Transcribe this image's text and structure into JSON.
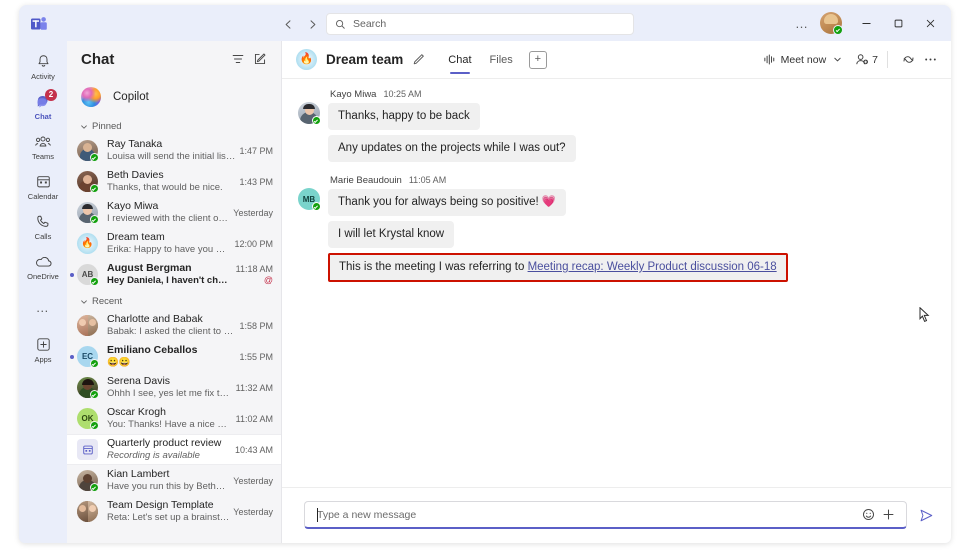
{
  "titlebar": {
    "app_logo": "teams-logo",
    "back_label": "Back",
    "forward_label": "Forward",
    "search_placeholder": "Search",
    "more_label": "…",
    "minimize_label": "Minimize",
    "maximize_label": "Maximize",
    "close_label": "Close"
  },
  "rail": {
    "items": [
      {
        "label": "Activity",
        "icon": "bell-icon",
        "badge": ""
      },
      {
        "label": "Chat",
        "icon": "chat-icon",
        "badge": "2"
      },
      {
        "label": "Teams",
        "icon": "teams-icon",
        "badge": ""
      },
      {
        "label": "Calendar",
        "icon": "calendar-icon",
        "badge": ""
      },
      {
        "label": "Calls",
        "icon": "phone-icon",
        "badge": ""
      },
      {
        "label": "OneDrive",
        "icon": "cloud-icon",
        "badge": ""
      }
    ],
    "more_label": "…",
    "apps_label": "Apps"
  },
  "chat_panel": {
    "title": "Chat",
    "filter_icon": "filter-icon",
    "compose_icon": "new-chat-icon",
    "copilot": {
      "label": "Copilot"
    },
    "groups": [
      {
        "label": "Pinned"
      },
      {
        "label": "Recent"
      }
    ],
    "pinned": [
      {
        "name": "Ray Tanaka",
        "preview": "Louisa will send the initial list of…",
        "time": "1:47 PM",
        "avatar_type": "photo",
        "avatar_color": "#8a7466",
        "initials": "RT",
        "unread": false,
        "bold": false,
        "mention": false
      },
      {
        "name": "Beth Davies",
        "preview": "Thanks, that would be nice.",
        "time": "1:43 PM",
        "avatar_type": "photo",
        "avatar_color": "#6b4a39",
        "initials": "BD",
        "unread": false,
        "bold": false,
        "mention": false
      },
      {
        "name": "Kayo Miwa",
        "preview": "I reviewed with the client on Th…",
        "time": "Yesterday",
        "avatar_type": "photo",
        "avatar_color": "#9fa8b8",
        "initials": "KM",
        "unread": false,
        "bold": false,
        "mention": false
      },
      {
        "name": "Dream team",
        "preview": "Erika: Happy to have you back…",
        "time": "12:00 PM",
        "avatar_type": "team",
        "avatar_color": "#a9dcef",
        "initials": "",
        "unread": false,
        "bold": false,
        "mention": false
      },
      {
        "name": "August Bergman",
        "preview": "Hey Daniela, I haven't checked…",
        "time": "11:18 AM",
        "avatar_type": "initials",
        "avatar_color": "#d6d6d6",
        "initials": "AB",
        "unread": true,
        "bold": true,
        "mention": true,
        "mention_glyph": "@"
      }
    ],
    "recent": [
      {
        "name": "Charlotte and Babak",
        "preview": "Babak: I asked the client to send…",
        "time": "1:58 PM",
        "avatar_type": "photo-duo",
        "avatar_color": "#a97f68",
        "initials": "CB",
        "unread": false,
        "bold": false,
        "mention": false
      },
      {
        "name": "Emiliano Ceballos",
        "preview": "😀😀",
        "time": "1:55 PM",
        "avatar_type": "initials",
        "avatar_color": "#9fd4ef",
        "initials": "EC",
        "unread": true,
        "bold": true,
        "mention": false
      },
      {
        "name": "Serena Davis",
        "preview": "Ohhh I see, yes let me fix that!",
        "time": "11:32 AM",
        "avatar_type": "photo",
        "avatar_color": "#4d3a2e",
        "initials": "SD",
        "unread": false,
        "bold": false,
        "mention": false
      },
      {
        "name": "Oscar Krogh",
        "preview": "You: Thanks! Have a nice day, I…",
        "time": "11:02 AM",
        "avatar_type": "initials",
        "avatar_color": "#a8d86a",
        "initials": "OK",
        "unread": false,
        "bold": false,
        "mention": false
      },
      {
        "name": "Quarterly product review",
        "preview": "Recording is available",
        "time": "10:43 AM",
        "avatar_type": "meeting",
        "avatar_color": "#e8e8f5",
        "initials": "",
        "unread": false,
        "bold": false,
        "italic": true,
        "selected": true,
        "mention": false
      },
      {
        "name": "Kian Lambert",
        "preview": "Have you run this by Beth? Mak…",
        "time": "Yesterday",
        "avatar_type": "photo",
        "avatar_color": "#8b6f5c",
        "initials": "KL",
        "unread": false,
        "bold": false,
        "mention": false
      },
      {
        "name": "Team Design Template",
        "preview": "Reta: Let's set up a brainstormi…",
        "time": "Yesterday",
        "avatar_type": "photo-duo",
        "avatar_color": "#7d6a59",
        "initials": "TD",
        "unread": false,
        "bold": false,
        "mention": false
      }
    ]
  },
  "main_header": {
    "team_name": "Dream team",
    "team_icon": "flame-icon",
    "edit_icon": "pencil-icon",
    "tabs": [
      {
        "label": "Chat",
        "active": true
      },
      {
        "label": "Files",
        "active": false
      }
    ],
    "add_tab_label": "+",
    "meet_now_label": "Meet now",
    "meet_now_icon": "meet-now-icon",
    "caret_icon": "chevron-down-icon",
    "people_count": "7",
    "people_icon": "people-icon",
    "copilot_icon": "copilot-icon",
    "more_icon": "more-options-icon"
  },
  "conversation": {
    "groups": [
      {
        "author": "Kayo Miwa",
        "time": "10:25 AM",
        "avatar_type": "photo",
        "avatar_color": "#9fa8b8",
        "initials": "KM",
        "messages": [
          {
            "text": "Thanks, happy to be back",
            "highlighted": false
          },
          {
            "text": "Any updates on the projects while I was out?",
            "highlighted": false
          }
        ]
      },
      {
        "author": "Marie Beaudouin",
        "time": "11:05 AM",
        "avatar_type": "initials",
        "avatar_color": "#6fd0c9",
        "initials": "MB",
        "messages": [
          {
            "text": "Thank you for always being so positive! ",
            "emoji": "💗",
            "highlighted": false
          },
          {
            "text": "I will let Krystal know",
            "highlighted": false
          },
          {
            "text": "This is the meeting I was referring to ",
            "link_text": "Meeting recap: Weekly Product discussion 06-18",
            "highlighted": true,
            "highlight_color": "#cc1100"
          }
        ]
      }
    ]
  },
  "compose": {
    "placeholder": "Type a new message",
    "emoji_icon": "emoji-icon",
    "plus_icon": "add-attachment-icon",
    "send_icon": "send-icon"
  }
}
